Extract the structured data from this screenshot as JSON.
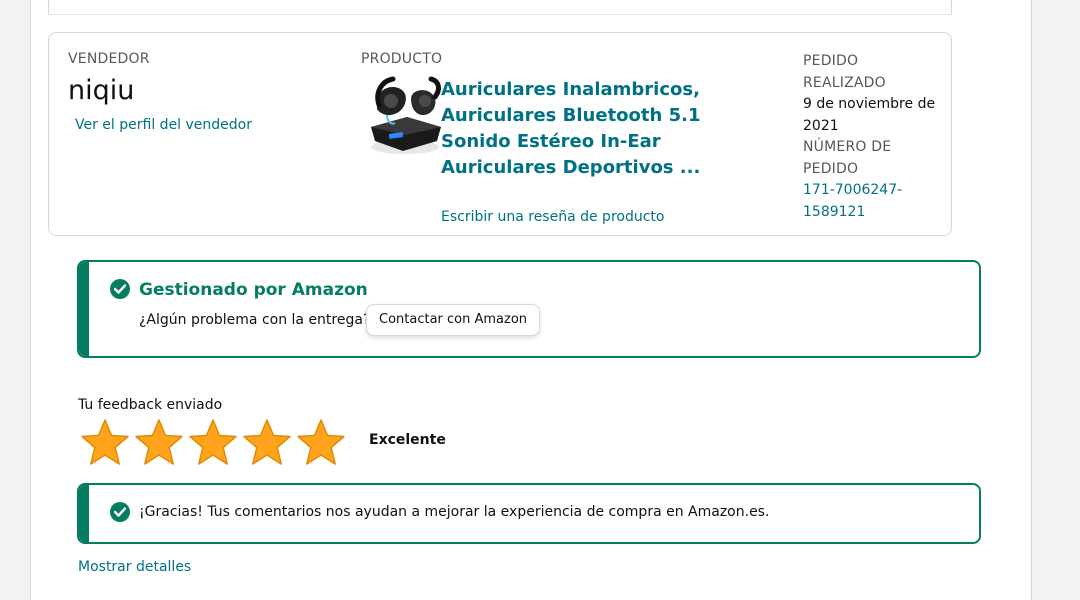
{
  "order_card": {
    "seller_label": "VENDEDOR",
    "seller_name": "niqiu",
    "seller_profile_link": "Ver el perfil del vendedor",
    "product_label": "PRODUCTO",
    "product_title": "Auriculares Inalambricos, Auriculares Bluetooth 5.1 Sonido Estéreo In-Ear Auriculares Deportivos ...",
    "review_link": "Escribir una reseña de producto",
    "product_image_icon": "earbuds-product-image",
    "order_placed_label": "PEDIDO REALIZADO",
    "order_date": "9 de noviembre de 2021",
    "order_number_label": "NÚMERO DE PEDIDO",
    "order_number": "171-7006247-1589121"
  },
  "managed_alert": {
    "title": "Gestionado por Amazon",
    "question": "¿Algún problema con la entrega?",
    "contact_button": "Contactar con Amazon",
    "icon": "check-circle-icon"
  },
  "feedback": {
    "label": "Tu feedback enviado",
    "rating": 5,
    "max_rating": 5,
    "rating_word": "Excelente"
  },
  "thanks_alert": {
    "text": "¡Gracias! Tus comentarios nos ayudan a mejorar la experiencia de compra en Amazon.es.",
    "icon": "check-circle-icon"
  },
  "show_details_link": "Mostrar detalles",
  "colors": {
    "link": "#007185",
    "success": "#067d62",
    "star": "#ffa41c",
    "border": "#d5d9d9"
  }
}
